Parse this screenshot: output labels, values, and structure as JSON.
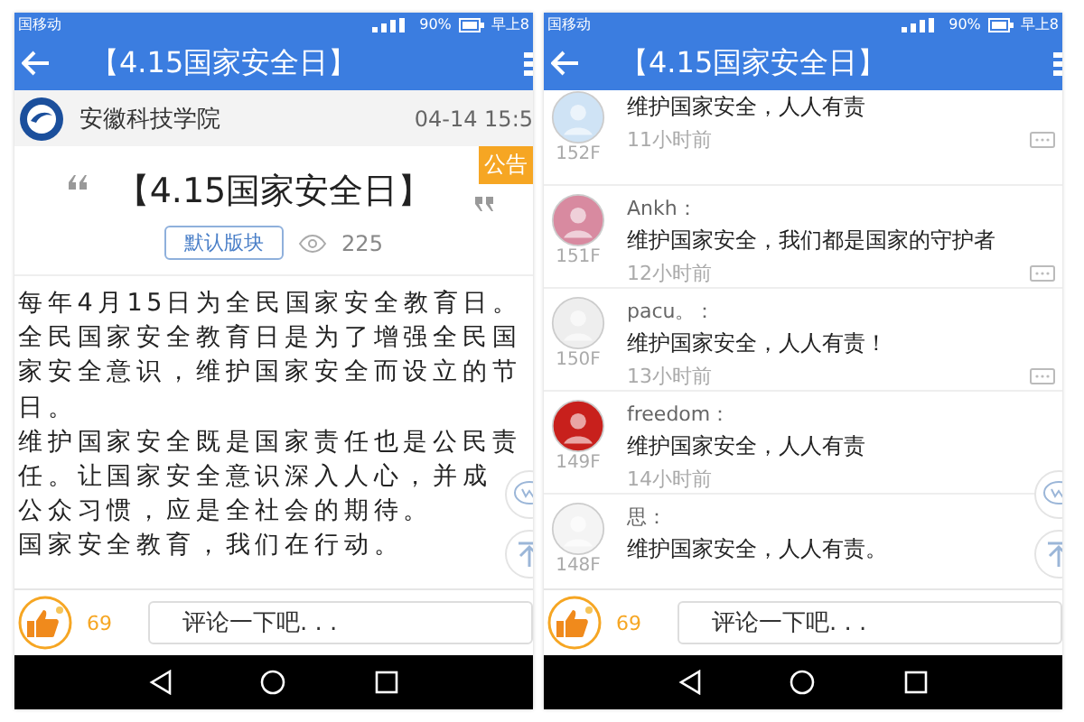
{
  "phones": [
    {
      "kind": "article",
      "status_bar": {
        "carrier": "国移动",
        "battery": "90%",
        "time": "早上8"
      },
      "app_bar": {
        "title": "【4.15国家安全日】"
      },
      "author": {
        "name": "安徽科技学院",
        "time": "04-14 15:5"
      },
      "badge": "公告",
      "title": "【4.15国家安全日】",
      "board": "默认版块",
      "views": "225",
      "body": [
        "每年4月15日为全民国家安全教育日。",
        "全民国家安全教育日是为了增强全民国",
        "家安全意识，维护国家安全而设立的节",
        "日。",
        "维护国家安全既是国家责任也是公民责",
        "任。让国家安全意识深入人心，并成",
        "公众习惯，应是全社会的期待。",
        "国家安全教育，我们在行动。"
      ],
      "likes": "69",
      "comment_field": {
        "placeholder": "评论一下吧. . ."
      }
    },
    {
      "kind": "comments",
      "status_bar": {
        "carrier": "国移动",
        "battery": "90%",
        "time": "早上8"
      },
      "app_bar": {
        "title": "【4.15国家安全日】"
      },
      "comments": [
        {
          "floor": "152F",
          "text": "维护国家安全，人人有责",
          "time": "11小时前"
        },
        {
          "floor": "151F",
          "name": "Ankh：",
          "text": "维护国家安全，我们都是国家的守护者",
          "time": "12小时前"
        },
        {
          "floor": "150F",
          "name": "pacu。：",
          "text": "维护国家安全，人人有责！",
          "time": "13小时前"
        },
        {
          "floor": "149F",
          "name": "freedom：",
          "text": "维护国家安全，人人有责",
          "time": "14小时前"
        },
        {
          "floor": "148F",
          "name": "思：",
          "text": "维护国家安全，人人有责。"
        }
      ],
      "likes": "69",
      "comment_field": {
        "placeholder": "评论一下吧. . ."
      }
    }
  ]
}
